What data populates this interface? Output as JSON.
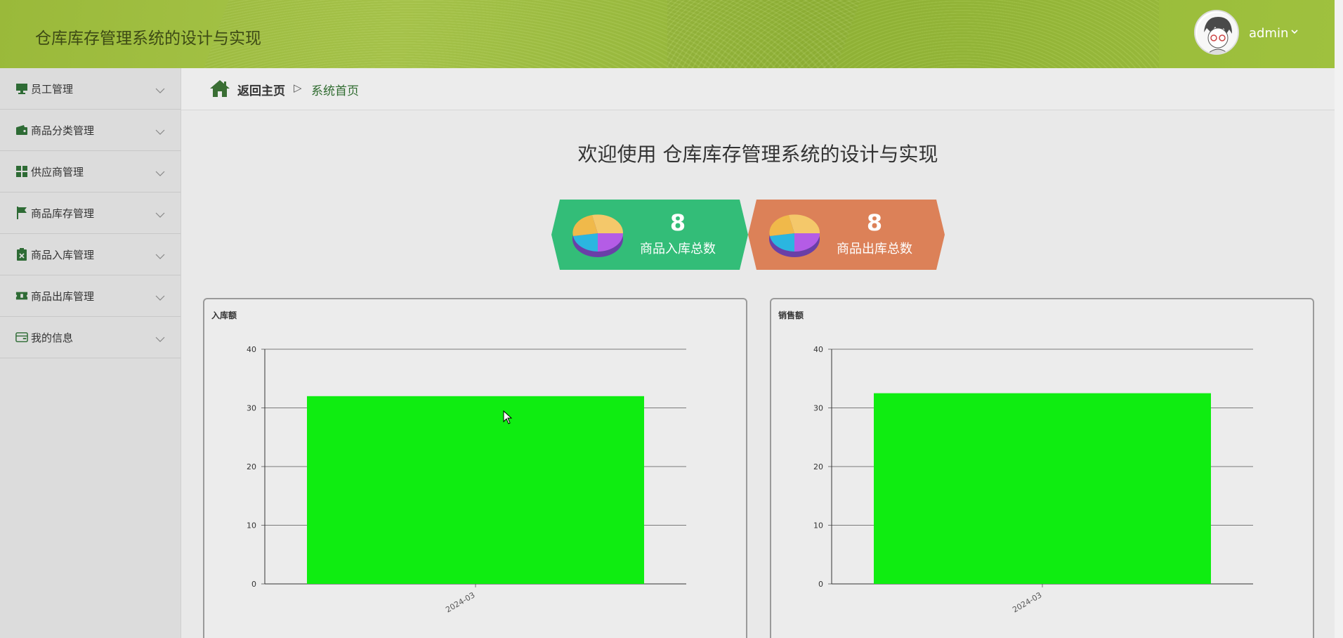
{
  "header": {
    "app_title": "仓库库存管理系统的设计与实现",
    "user": "admin"
  },
  "sidebar": {
    "items": [
      {
        "label": "员工管理",
        "icon": "monitor-icon"
      },
      {
        "label": "商品分类管理",
        "icon": "wallet-icon"
      },
      {
        "label": "供应商管理",
        "icon": "grid-icon"
      },
      {
        "label": "商品库存管理",
        "icon": "flag-icon"
      },
      {
        "label": "商品入库管理",
        "icon": "clipboard-x-icon"
      },
      {
        "label": "商品出库管理",
        "icon": "ticket-icon"
      },
      {
        "label": "我的信息",
        "icon": "card-icon"
      }
    ]
  },
  "breadcrumb": {
    "home": "返回主页",
    "separator": "▷",
    "current": "系统首页"
  },
  "welcome": "欢迎使用 仓库库存管理系统的设计与实现",
  "stats": [
    {
      "value": "8",
      "label": "商品入库总数",
      "color": "#33bd78"
    },
    {
      "value": "8",
      "label": "商品出库总数",
      "color": "#dc8158"
    }
  ],
  "chart_data": [
    {
      "type": "bar",
      "title": "入库额",
      "categories": [
        "2024-03"
      ],
      "values": [
        32
      ],
      "ylim": [
        0,
        40
      ],
      "yticks": [
        0,
        10,
        20,
        30,
        40
      ],
      "grid": true,
      "color": "#0fed11"
    },
    {
      "type": "bar",
      "title": "销售额",
      "categories": [
        "2024-03"
      ],
      "values": [
        32.5
      ],
      "ylim": [
        0,
        40
      ],
      "yticks": [
        0,
        10,
        20,
        30,
        40
      ],
      "grid": true,
      "color": "#0fed11"
    }
  ]
}
